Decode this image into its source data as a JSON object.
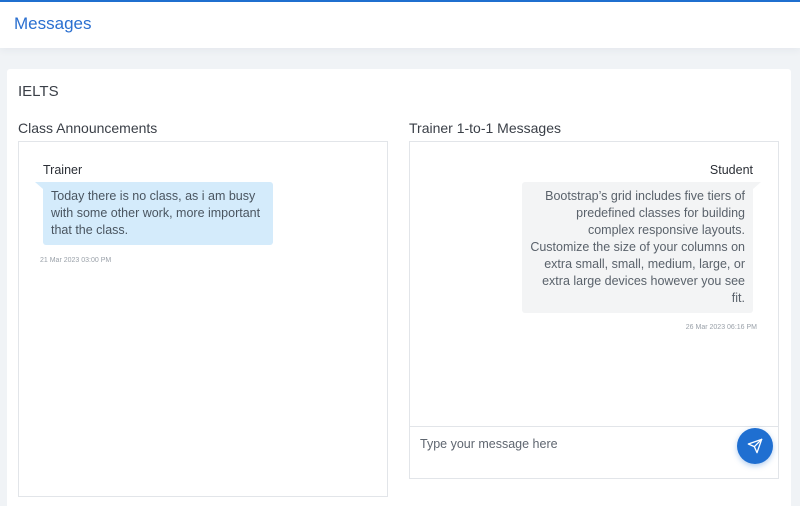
{
  "header": {
    "title": "Messages"
  },
  "course": {
    "title": "IELTS"
  },
  "announcements": {
    "title": "Class Announcements",
    "messages": [
      {
        "sender": "Trainer",
        "text": "Today there is no class, as i am busy with some other work, more important that the class.",
        "timestamp": "21 Mar 2023 03:00 PM"
      }
    ]
  },
  "direct": {
    "title": "Trainer 1-to-1 Messages",
    "messages": [
      {
        "sender": "Student",
        "text": "Bootstrap’s grid includes five tiers of predefined classes for building complex responsive layouts. Customize the size of your columns on extra small, small, medium, large, or extra large devices however you see fit.",
        "timestamp": "26 Mar 2023 06:16 PM"
      }
    ],
    "input": {
      "placeholder": "Type your message here",
      "value": ""
    },
    "send_icon": "paper-plane-icon"
  },
  "colors": {
    "accent": "#1f6fd1",
    "incoming_bubble": "#d4ebfb",
    "outgoing_bubble": "#f3f4f5"
  }
}
